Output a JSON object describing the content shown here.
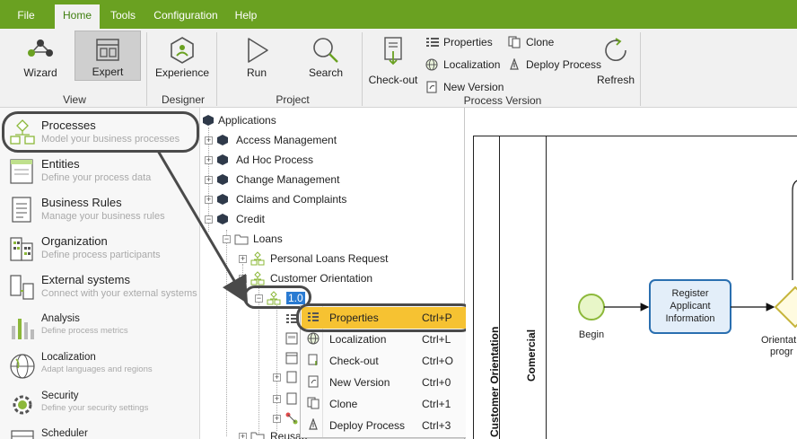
{
  "menu": {
    "tabs": [
      {
        "label": "File"
      },
      {
        "label": "Home"
      },
      {
        "label": "Tools"
      },
      {
        "label": "Configuration"
      },
      {
        "label": "Help"
      }
    ]
  },
  "ribbon": {
    "view": {
      "group": "View",
      "wizard": "Wizard",
      "expert": "Expert"
    },
    "designer": {
      "group": "Designer",
      "experience": "Experience"
    },
    "project": {
      "group": "Project",
      "run": "Run",
      "search": "Search"
    },
    "process_version": {
      "group": "Process Version",
      "checkout": "Check-out",
      "properties": "Properties",
      "localization": "Localization",
      "new_version": "New Version",
      "clone": "Clone",
      "deploy": "Deploy Process"
    },
    "refresh": "Refresh"
  },
  "leftnav": {
    "items": [
      {
        "title": "Processes",
        "subtitle": "Model your business processes"
      },
      {
        "title": "Entities",
        "subtitle": "Define your process data"
      },
      {
        "title": "Business Rules",
        "subtitle": "Manage your business rules"
      },
      {
        "title": "Organization",
        "subtitle": "Define process participants"
      },
      {
        "title": "External systems",
        "subtitle": "Connect with your external systems"
      },
      {
        "title": "Analysis",
        "subtitle": "Define process metrics"
      },
      {
        "title": "Localization",
        "subtitle": "Adapt languages and regions"
      },
      {
        "title": "Security",
        "subtitle": "Define your security settings"
      },
      {
        "title": "Scheduler",
        "subtitle": ""
      }
    ]
  },
  "tree": {
    "root": "Applications",
    "apps": [
      "Access Management",
      "Ad Hoc Process",
      "Change Management",
      "Claims and Complaints",
      "Credit"
    ],
    "loans": "Loans",
    "personal_loans": "Personal Loans Request",
    "customer_orientation": "Customer Orientation",
    "version": "1.0",
    "reusable": "Reusab"
  },
  "context_menu": {
    "items": [
      {
        "label": "Properties",
        "shortcut": "Ctrl+P"
      },
      {
        "label": "Localization",
        "shortcut": "Ctrl+L"
      },
      {
        "label": "Check-out",
        "shortcut": "Ctrl+O"
      },
      {
        "label": "New Version",
        "shortcut": "Ctrl+0"
      },
      {
        "label": "Clone",
        "shortcut": "Ctrl+1"
      },
      {
        "label": "Deploy Process",
        "shortcut": "Ctrl+3"
      }
    ]
  },
  "canvas": {
    "pool": "Customer Orientation",
    "lane": "Comercial",
    "start": "Begin",
    "task": {
      "line1": "Register",
      "line2": "Applicant",
      "line3": "Information"
    },
    "gateway_line1": "Orientat",
    "gateway_line2": "progr"
  },
  "colors": {
    "accent": "#6aa121",
    "highlight": "#f6c232",
    "task_fill": "#e3eef9",
    "task_border": "#2a6fb0",
    "event_fill": "#e8f6c8",
    "event_border": "#8cb83a",
    "gateway_fill": "#fffbe0",
    "gateway_border": "#c6b43a"
  }
}
